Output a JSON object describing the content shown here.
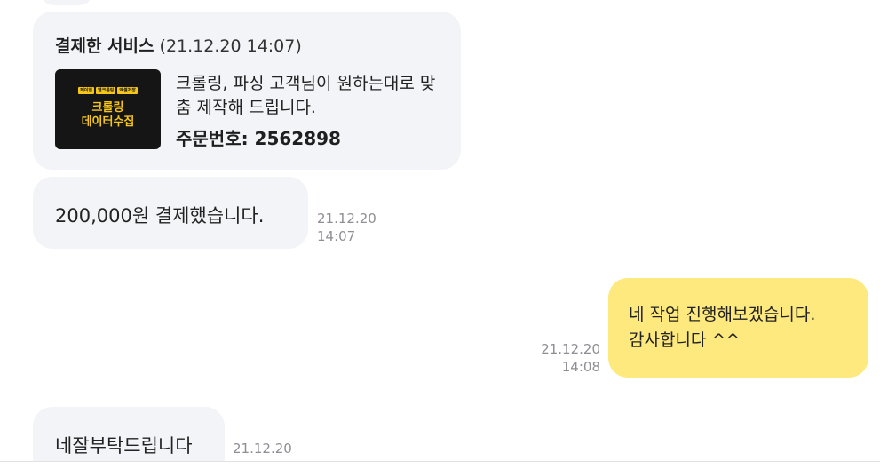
{
  "messages": {
    "service_card": {
      "title": "결제한 서비스",
      "datetime": "(21.12.20 14:07)",
      "thumbnail": {
        "tags": [
          "페이헌",
          "웹크롤링",
          "엑셀저장"
        ],
        "title_line1": "크롤링",
        "title_line2": "데이터수집"
      },
      "description": "크롤링, 파싱 고객님이 원하는대로 맞춤 제작해 드립니다.",
      "order_number": "주문번호: 2562898"
    },
    "payment": {
      "text": "200,000원 결제했습니다.",
      "date": "21.12.20",
      "time": "14:07"
    },
    "reply": {
      "line1": "네 작업 진행해보겠습니다.",
      "line2": "감사합니다 ^^",
      "date": "21.12.20",
      "time": "14:08"
    },
    "last": {
      "text": "네잘부탁드립니다",
      "date": "21.12.20"
    }
  },
  "colors": {
    "incoming_bubble": "#f3f4f8",
    "outgoing_bubble": "#fde97d",
    "timestamp": "#8e8e93",
    "thumbnail_bg": "#151515",
    "thumbnail_accent": "#f5c518"
  }
}
